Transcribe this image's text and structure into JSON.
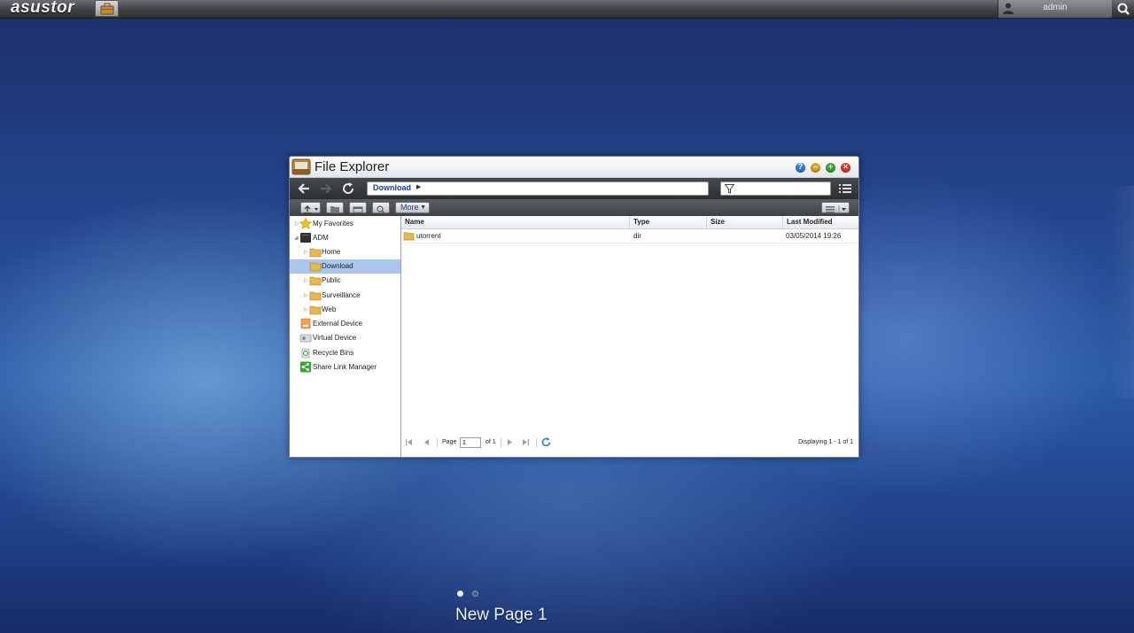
{
  "topbar": {
    "logo": "asustor",
    "user": "admin"
  },
  "window": {
    "title": "File Explorer",
    "path": "Download",
    "filter_placeholder": "",
    "more_label": "More"
  },
  "sidebar": {
    "items": [
      {
        "label": "My Favorites"
      },
      {
        "label": "ADM"
      },
      {
        "label": "Home"
      },
      {
        "label": "Download"
      },
      {
        "label": "Public"
      },
      {
        "label": "Surveillance"
      },
      {
        "label": "Web"
      },
      {
        "label": "External Device"
      },
      {
        "label": "Virtual Device"
      },
      {
        "label": "Recycle Bins"
      },
      {
        "label": "Share Link Manager"
      }
    ]
  },
  "grid": {
    "columns": [
      "Name",
      "Type",
      "Size",
      "Last Modified"
    ],
    "rows": [
      {
        "name": "utorrent",
        "type": "dir",
        "size": "",
        "modified": "03/05/2014 19:26"
      }
    ]
  },
  "pager": {
    "page_label": "Page",
    "page_value": "1",
    "of_label": "of 1",
    "displaying": "Displaying 1 - 1 of 1"
  },
  "desktop": {
    "page_name": "New Page 1"
  },
  "colors": {
    "accent": "#1b3f86",
    "selection": "#aac6ec",
    "help_btn": "#2f7fd0",
    "minimize_btn": "#e1a21c",
    "maximize_btn": "#3aa435",
    "close_btn": "#d93a2e"
  }
}
